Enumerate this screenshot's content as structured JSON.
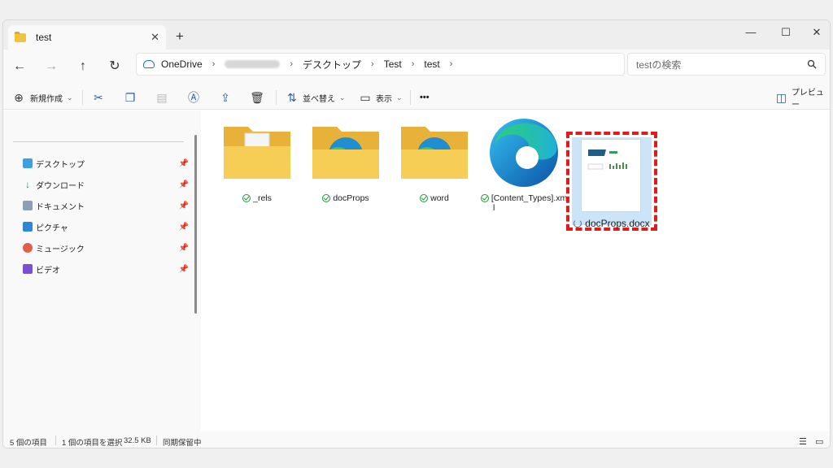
{
  "window": {
    "tab_title": "test",
    "tab_close": "✕",
    "new_tab": "+",
    "controls": {
      "minimize": "—",
      "maximize": "☐",
      "close": "✕"
    }
  },
  "nav": {
    "back": "←",
    "forward": "→",
    "up": "↑",
    "refresh": "↻",
    "breadcrumb": [
      "OneDrive",
      "デスクトップ",
      "Test",
      "test"
    ],
    "separator": "›",
    "search_placeholder": "testの検索",
    "search_icon": "search-icon"
  },
  "toolbar": {
    "new_label": "新規作成",
    "sort_label": "並べ替え",
    "view_label": "表示",
    "more_label": "•••",
    "preview_label": "プレビュー",
    "dropdown_caret": "⌄"
  },
  "sidebar": {
    "items": [
      {
        "label": "デスクトップ",
        "color": "#3fa0e0"
      },
      {
        "label": "ダウンロード",
        "color": "#2f8f5b"
      },
      {
        "label": "ドキュメント",
        "color": "#8aa0b8"
      },
      {
        "label": "ピクチャ",
        "color": "#2f86d6"
      },
      {
        "label": "ミュージック",
        "color": "#e0604a"
      },
      {
        "label": "ビデオ",
        "color": "#7a4fd0"
      }
    ],
    "pin_glyph": "📌"
  },
  "files": [
    {
      "name": "_rels",
      "type": "folder-doc",
      "status": "synced"
    },
    {
      "name": "docProps",
      "type": "folder-edge",
      "status": "synced"
    },
    {
      "name": "word",
      "type": "folder-edge",
      "status": "synced"
    },
    {
      "name": "[Content_Types].xm",
      "name_line2": "l",
      "type": "edge-file",
      "status": "synced"
    },
    {
      "name": "docProps.docx",
      "type": "docx",
      "status": "syncing",
      "selected": true
    }
  ],
  "status": {
    "count": "5 個の項目",
    "selection": "1 個の項目を選択",
    "size": "32.5 KB",
    "sync_state": "同期保留中"
  },
  "colors": {
    "folder": "#f4c542",
    "selection": "#cce4f7",
    "highlight_border": "#e01b1b",
    "accent": "#2d5d9c"
  }
}
